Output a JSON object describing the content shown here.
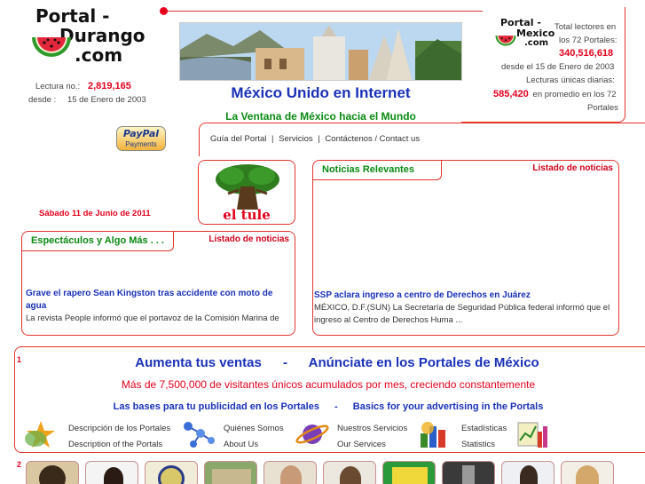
{
  "portal_logo": {
    "line1": "Portal -",
    "line2": "Durango",
    "line3": ".com"
  },
  "reads": {
    "label": "Lectura no.:",
    "value": "2,819,165",
    "since_label": "desde :",
    "since_value": "15 de Enero de 2003"
  },
  "headline": "México Unido en Internet",
  "subheadline": "La Ventana de México hacia el Mundo",
  "paypal": {
    "line1": "PayPal",
    "line2": "Payments"
  },
  "nav": {
    "items": [
      "Guía del Portal",
      "Servicios",
      "Contáctenos / Contact us"
    ],
    "separator": "|"
  },
  "mexico_logo": {
    "line1": "Portal -",
    "line2": "Mexico",
    "line3": ".com"
  },
  "stats": {
    "total_label_1": "Total lectores en",
    "total_label_2": "los 72 Portales:",
    "total_value": "340,516,618",
    "since": "desde el 15 de Enero de 2003",
    "unique_label": "Lecturas únicas diarias:",
    "unique_value": "585,420",
    "unique_suffix_1": "en promedio en los 72",
    "unique_suffix_2": "Portales"
  },
  "date": "Sábado 11 de Junio de 2011",
  "tule": {
    "caption": "el tule"
  },
  "espectaculos": {
    "title": "Espectáculos y Algo Más . . .",
    "list_link": "Listado de noticias",
    "headline": "Grave el rapero Sean Kingston tras accidente con moto de agua",
    "body": "La revista People informó que el portavoz de la Comisión Marina de"
  },
  "noticias": {
    "title": "Noticias Relevantes",
    "list_link": "Listado de noticias",
    "headline": "SSP aclara ingreso a centro de Derechos en Juárez",
    "body": "MÉXICO, D.F.(SUN) La Secretaría de Seguridad Pública federal informó que el ingreso al Centro de Derechos Huma ..."
  },
  "ad": {
    "number": "1",
    "title_left": "Aumenta tus ventas",
    "title_sep": "-",
    "title_right": "Anúnciate en los Portales de México",
    "subtitle": "Más de 7,500,000 de visitantes únicos acumulados por mes, creciendo constantemente",
    "bases_es": "Las bases para tu publicidad en los Portales",
    "bases_sep": "-",
    "bases_en": "Basics for your advertising in the Portals",
    "links": [
      {
        "es": "Descripción de los Portales",
        "en": "Description of the Portals",
        "icon": "star-icon"
      },
      {
        "es": "Quiénes Somos",
        "en": "About Us",
        "icon": "molecule-icon"
      },
      {
        "es": "Nuestros Servicios",
        "en": "Our Services",
        "icon": "planet-icon"
      },
      {
        "es": "Estadísticas",
        "en": "Statistics",
        "icon": "bar-chart-icon"
      }
    ]
  },
  "bottom": {
    "number": "2"
  },
  "colors": {
    "accent_red": "#e4001b",
    "link_blue": "#1a31b8",
    "green": "#0a8a12",
    "frame": "#e2352f"
  }
}
